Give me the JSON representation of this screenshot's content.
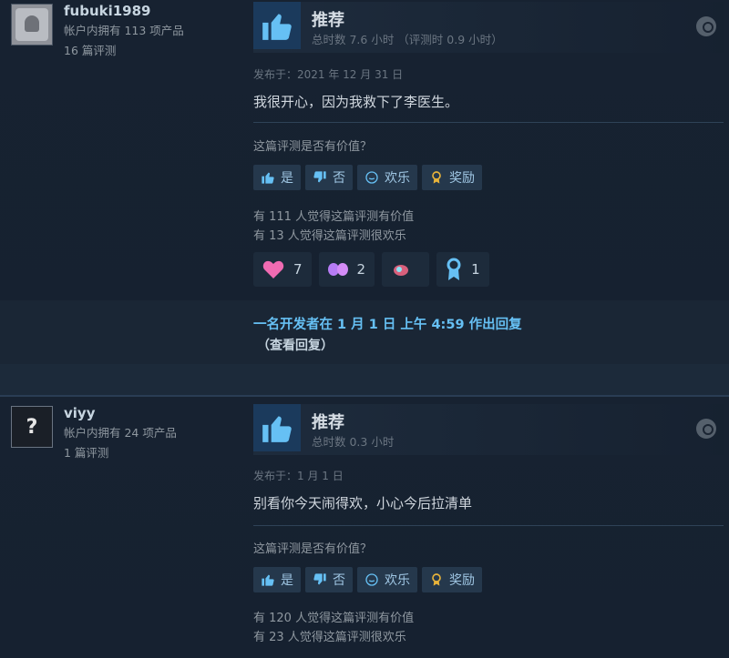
{
  "reviews": [
    {
      "user": {
        "name": "fubuki1989",
        "products": "帐户内拥有 113 项产品",
        "reviews": "16 篇评测"
      },
      "recommend": "推荐",
      "hours": "总时数 7.6 小时 （评测时 0.9 小时）",
      "posted": "发布于：2021 年 12 月 31 日",
      "text": "我很开心，因为我救下了李医生。",
      "question": "这篇评测是否有价值？",
      "buttons": {
        "yes": "是",
        "no": "否",
        "funny": "欢乐",
        "award": "奖励"
      },
      "helpful": "有 111 人觉得这篇评测有价值",
      "funny_count": "有 13 人觉得这篇评测很欢乐",
      "awards": [
        "7",
        "2",
        "",
        "1"
      ],
      "dev_reply": "一名开发者在 1 月 1 日 上午 4:59 作出回复",
      "see_reply": "（查看回复）"
    },
    {
      "user": {
        "name": "viyy",
        "products": "帐户内拥有 24 项产品",
        "reviews": "1 篇评测"
      },
      "recommend": "推荐",
      "hours": "总时数 0.3 小时",
      "posted": "发布于：1 月 1 日",
      "text": "别看你今天闹得欢，小心今后拉清单",
      "question": "这篇评测是否有价值？",
      "buttons": {
        "yes": "是",
        "no": "否",
        "funny": "欢乐",
        "award": "奖励"
      },
      "helpful": "有 120 人觉得这篇评测有价值",
      "funny_count": "有 23 人觉得这篇评测很欢乐"
    }
  ],
  "avatar2_glyph": "?",
  "colors": {
    "accent": "#66c0f4",
    "background": "#1b2838",
    "button": "#25384c"
  }
}
